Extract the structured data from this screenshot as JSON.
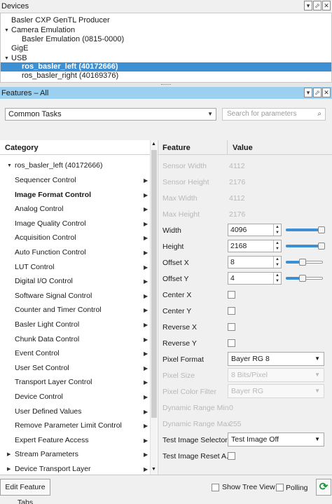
{
  "devices_panel": {
    "title": "Devices",
    "tree": [
      {
        "label": "Basler CXP GenTL Producer"
      },
      {
        "label": "Camera Emulation"
      },
      {
        "label": "Basler Emulation (0815-0000)"
      },
      {
        "label": "GigE"
      },
      {
        "label": "USB"
      },
      {
        "label": "ros_basler_left (40172666)"
      },
      {
        "label": "ros_basler_right (40169376)"
      }
    ]
  },
  "features_panel": {
    "title": "Features – All",
    "view_select": "Common Tasks",
    "search_placeholder": "Search for parameters",
    "category_header": "Category",
    "feature_header": "Feature",
    "value_header": "Value",
    "root_category": "ros_basler_left (40172666)",
    "categories": [
      "Sequencer Control",
      "Image Format Control",
      "Analog Control",
      "Image Quality Control",
      "Acquisition Control",
      "Auto Function Control",
      "LUT Control",
      "Digital I/O Control",
      "Software Signal Control",
      "Counter and Timer Control",
      "Basler Light Control",
      "Chunk Data Control",
      "Event Control",
      "User Set Control",
      "Transport Layer Control",
      "Device Control",
      "User Defined Values",
      "Remove Parameter Limit Control",
      "Expert Feature Access",
      "Stream Parameters",
      "Device Transport Layer"
    ],
    "features": [
      {
        "name": "Sensor Width",
        "value": "4112"
      },
      {
        "name": "Sensor Height",
        "value": "2176"
      },
      {
        "name": "Max Width",
        "value": "4112"
      },
      {
        "name": "Max Height",
        "value": "2176"
      },
      {
        "name": "Width",
        "value": "4096",
        "slider": 0.97
      },
      {
        "name": "Height",
        "value": "2168",
        "slider": 0.97
      },
      {
        "name": "Offset X",
        "value": "8",
        "slider": 0.45
      },
      {
        "name": "Offset Y",
        "value": "4",
        "slider": 0.45
      },
      {
        "name": "Center X"
      },
      {
        "name": "Center Y"
      },
      {
        "name": "Reverse X"
      },
      {
        "name": "Reverse Y"
      },
      {
        "name": "Pixel Format",
        "value": "Bayer RG 8"
      },
      {
        "name": "Pixel Size",
        "value": "8 Bits/Pixel"
      },
      {
        "name": "Pixel Color Filter",
        "value": "Bayer RG"
      },
      {
        "name": "Dynamic Range Min",
        "value": "0"
      },
      {
        "name": "Dynamic Range Max",
        "value": "255"
      },
      {
        "name": "Test Image Selector",
        "value": "Test Image Off"
      },
      {
        "name": "Test Image Reset A..."
      }
    ]
  },
  "bottom_bar": {
    "edit_tabs": "Edit Feature Tabs",
    "show_tree": "Show Tree View",
    "polling": "Polling"
  },
  "colors": {
    "selection": "#3d8fd4",
    "active_title": "#9bd0f0",
    "refresh": "#1a9a3a"
  }
}
